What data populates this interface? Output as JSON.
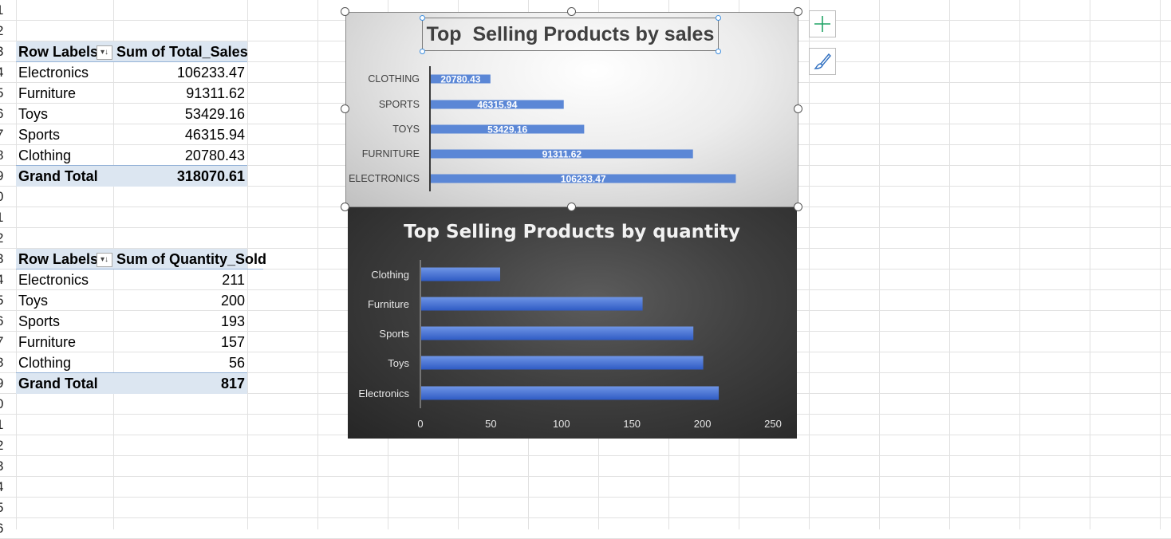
{
  "row_numbers": [
    "1",
    "2",
    "3",
    "4",
    "5",
    "6",
    "7",
    "8",
    "9",
    "0",
    "1",
    "2",
    "3",
    "4",
    "5",
    "6",
    "7",
    "8",
    "9",
    "0",
    "1",
    "2",
    "3",
    "4",
    "5",
    "6"
  ],
  "pivot_sales": {
    "header_label": "Row Labels",
    "header_value": "Sum of Total_Sales",
    "rows": [
      {
        "label": "Electronics",
        "value": "106233.47"
      },
      {
        "label": "Furniture",
        "value": "91311.62"
      },
      {
        "label": "Toys",
        "value": "53429.16"
      },
      {
        "label": "Sports",
        "value": "46315.94"
      },
      {
        "label": "Clothing",
        "value": "20780.43"
      }
    ],
    "total_label": "Grand Total",
    "total_value": "318070.61"
  },
  "pivot_quantity": {
    "header_label": "Row Labels",
    "header_value": "Sum of Quantity_Sold",
    "rows": [
      {
        "label": "Electronics",
        "value": "211"
      },
      {
        "label": "Toys",
        "value": "200"
      },
      {
        "label": "Sports",
        "value": "193"
      },
      {
        "label": "Furniture",
        "value": "157"
      },
      {
        "label": "Clothing",
        "value": "56"
      }
    ],
    "total_label": "Grand Total",
    "total_value": "817"
  },
  "chart_data": [
    {
      "type": "bar",
      "title": "Top  Selling Products by sales",
      "categories": [
        "CLOTHING",
        "SPORTS",
        "TOYS",
        "FURNITURE",
        "ELECTRONICS"
      ],
      "values": [
        20780.43,
        46315.94,
        53429.16,
        91311.62,
        106233.47
      ],
      "data_labels": [
        "20780.43",
        "46315.94",
        "53429.16",
        "91311.62",
        "106233.47"
      ],
      "xlim": [
        0,
        120000
      ],
      "axis_visible": false,
      "bar_color": "#5b87d6",
      "background": "light gradient",
      "selected": true
    },
    {
      "type": "bar",
      "title": "Top Selling Products by quantity",
      "categories": [
        "Clothing",
        "Furniture",
        "Sports",
        "Toys",
        "Electronics"
      ],
      "values": [
        56,
        157,
        193,
        200,
        211
      ],
      "xlim": [
        0,
        250
      ],
      "xticks": [
        "0",
        "50",
        "100",
        "150",
        "200",
        "250"
      ],
      "bar_color": "#3f6fd1",
      "background": "dark gradient"
    }
  ],
  "chart_tools": {
    "add_element_icon": "plus-icon",
    "style_icon": "paintbrush-icon"
  }
}
